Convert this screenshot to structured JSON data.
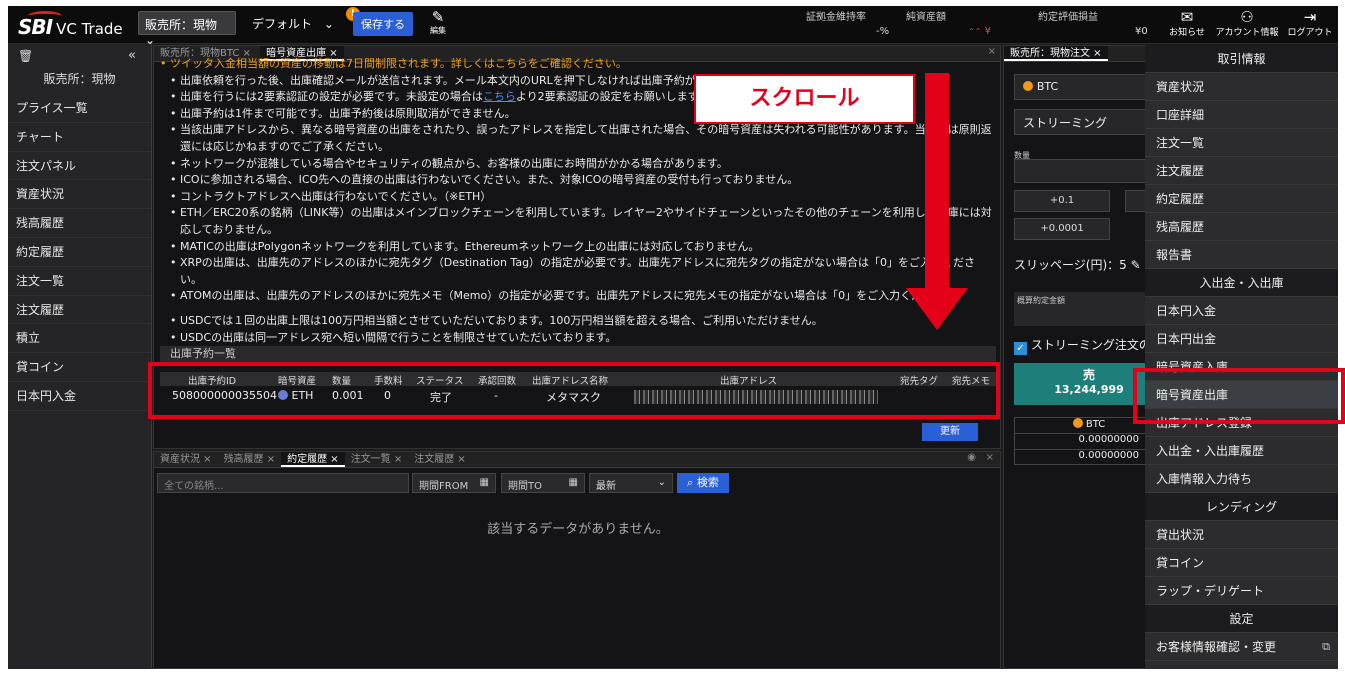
{
  "brand": {
    "sbi": "SBI",
    "name": "VC Trade"
  },
  "header": {
    "market_select": "販売所：現物",
    "layout_select": "デフォルト",
    "save_button": "保存する",
    "notif_badge": "!",
    "edit_label": "編集",
    "margin_rate_label": "証拠金維持率",
    "margin_rate_value": "-%",
    "net_assets_label": "純資産額",
    "net_assets_value": "¥",
    "unrealized_label": "約定評価損益",
    "unrealized_value": "¥0",
    "notice_label": "お知らせ",
    "account_label": "アカウント情報",
    "logout_label": "ログアウト"
  },
  "sidebar": {
    "collapse": "«",
    "title": "販売所：現物",
    "items": [
      "プライス一覧",
      "チャート",
      "注文パネル",
      "資産状況",
      "残高履歴",
      "約定履歴",
      "注文一覧",
      "注文履歴",
      "積立",
      "貸コイン",
      "日本円入金"
    ]
  },
  "main_panel": {
    "tabs": [
      "販売所：現物BTC",
      "暗号資産出庫"
    ],
    "top_cut_line": "ツイッタ入金相当額の資産の移動は7日間制限されます。詳しくはこちらをご確認ください。",
    "bullets": [
      {
        "pre": "出庫依頼を行った後、出庫確認メールが送信されます。メール本文内のURLを押下しなければ出庫予約が",
        "link": "",
        "post": ""
      },
      {
        "pre": "出庫を行うには2要素認証の設定が必要です。未設定の場合は",
        "link": "こちら",
        "post": "より2要素認証の設定をお願いします。"
      },
      {
        "pre": "出庫予約は1件まで可能です。出庫予約後は原則取消ができません。",
        "link": "",
        "post": ""
      },
      {
        "pre": "当該出庫アドレスから、異なる暗号資産の出庫をされたり、誤ったアドレスを指定して出庫された場合、その暗号資産は失われる可能性があります。当社では原則返還には応じかねますのでご了承ください。",
        "link": "",
        "post": ""
      },
      {
        "pre": "ネットワークが混雑している場合やセキュリティの観点から、お客様の出庫にお時間がかかる場合があります。",
        "link": "",
        "post": ""
      },
      {
        "pre": "ICOに参加される場合、ICO先への直接の出庫は行わないでください。また、対象ICOの暗号資産の受付も行っておりません。",
        "link": "",
        "post": ""
      },
      {
        "pre": "コントラクトアドレスへ出庫は行わないでください。（※ETH）",
        "link": "",
        "post": ""
      },
      {
        "pre": "ETH／ERC20系の銘柄（LINK等）の出庫はメインブロックチェーンを利用しています。レイヤー2やサイドチェーンといったその他のチェーンを利用した出庫には対応しておりません。",
        "link": "",
        "post": ""
      },
      {
        "pre": "MATICの出庫はPolygonネットワークを利用しています。Ethereumネットワーク上の出庫には対応しておりません。",
        "link": "",
        "post": ""
      },
      {
        "pre": "XRPの出庫は、出庫先のアドレスのほかに宛先タグ（Destination Tag）の指定が必要です。出庫先アドレスに宛先タグの指定がない場合は「0」をご入力ください。",
        "link": "",
        "post": ""
      },
      {
        "pre": "ATOMの出庫は、出庫先のアドレスのほかに宛先メモ（Memo）の指定が必要です。出庫先アドレスに宛先メモの指定がない場合は「0」をご入力ください。",
        "link": "",
        "post": ""
      }
    ],
    "bullets2": [
      "USDCでは１回の出庫上限は100万円相当額とさせていただいております。100万円相当額を超える場合、ご利用いただけません。",
      "USDCの出庫は同一アドレス宛へ短い間隔で行うことを制限させていただいております。"
    ],
    "list_title": "出庫予約一覧",
    "columns": [
      "出庫予約ID",
      "暗号資産",
      "数量",
      "手数料",
      "ステータス",
      "承認回数",
      "出庫アドレス名称",
      "出庫アドレス",
      "宛先タグ",
      "宛先メモ"
    ],
    "row": {
      "id": "508000000035504",
      "asset": "ETH",
      "qty": "0.001",
      "fee": "0",
      "status": "完了",
      "approvals": "-",
      "addr_name": "メタマスク"
    },
    "refresh_button": "更新"
  },
  "annotation": {
    "label": "スクロール"
  },
  "bottom_panel": {
    "tabs": [
      "資産状況",
      "残高履歴",
      "約定履歴",
      "注文一覧",
      "注文履歴"
    ],
    "search_placeholder": "全ての銘柄...",
    "from_label": "期間FROM",
    "to_label": "期間TO",
    "sort_select": "最新",
    "search_button": "検索",
    "empty_msg": "該当するデータがありません。"
  },
  "order_panel": {
    "tab": "販売所：現物注文",
    "asset": "BTC",
    "mode": "ストリーミング",
    "qty_label": "数量",
    "inc1": "+0.1",
    "inc2": "+0.0001",
    "slippage": "スリッページ(円)：5",
    "amount_label": "概算約定金額",
    "streaming_check": "ストリーミング注文の",
    "sell_label": "売",
    "sell_price": "13,244,999",
    "bal_asset": "BTC",
    "bal1": "0.00000000",
    "bal2": "0.00000000"
  },
  "menu": {
    "sections": [
      {
        "head": "取引情報",
        "items": [
          "資産状況",
          "口座詳細",
          "注文一覧",
          "注文履歴",
          "約定履歴",
          "残高履歴",
          "報告書"
        ]
      },
      {
        "head": "入出金・入出庫",
        "items": [
          "日本円入金",
          "日本円出金",
          "暗号資産入庫",
          "暗号資産出庫",
          "出庫アドレス登録",
          "入出金・入出庫履歴",
          "入庫情報入力待ち"
        ]
      },
      {
        "head": "レンディング",
        "items": [
          "貸出状況",
          "貸コイン",
          "ラップ・デリゲート"
        ]
      },
      {
        "head": "設定",
        "items": [
          "お客様情報確認・変更"
        ]
      }
    ],
    "highlighted": "暗号資産出庫"
  },
  "colors": {
    "accent": "#2b5fd6",
    "highlight": "#e5001a",
    "brand_red": "#d3261c"
  }
}
